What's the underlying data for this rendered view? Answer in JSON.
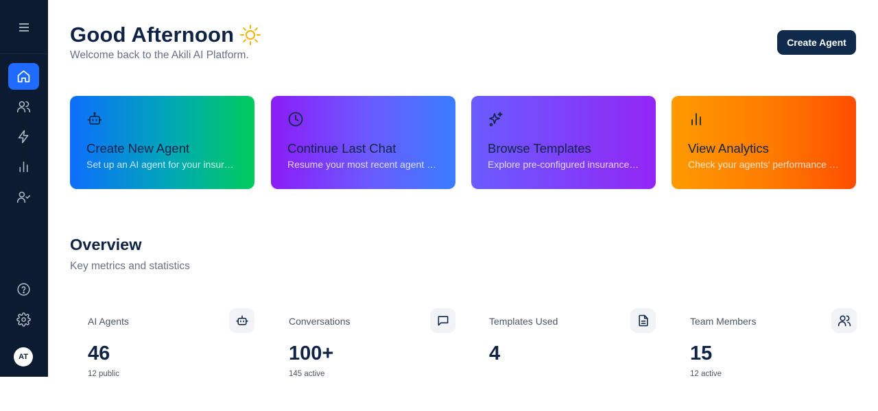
{
  "sidebar": {
    "menu_icon": "menu-icon",
    "items": [
      {
        "name": "home",
        "icon": "home-icon",
        "active": true
      },
      {
        "name": "users",
        "icon": "users-icon",
        "active": false
      },
      {
        "name": "automations",
        "icon": "lightning-icon",
        "active": false
      },
      {
        "name": "analytics",
        "icon": "bar-chart-icon",
        "active": false
      },
      {
        "name": "team",
        "icon": "user-check-icon",
        "active": false
      }
    ],
    "bottom": [
      {
        "name": "help",
        "icon": "help-circle-icon"
      },
      {
        "name": "settings",
        "icon": "gear-icon"
      }
    ],
    "avatar_initials": "AT"
  },
  "header": {
    "title": "Good Afternoon",
    "subtitle": "Welcome back to the Akili AI Platform.",
    "create_label": "Create Agent"
  },
  "quick_actions": [
    {
      "title": "Create New Agent",
      "description": "Set up an AI agent for your insurance business",
      "icon": "robot-icon"
    },
    {
      "title": "Continue Last Chat",
      "description": "Resume your most recent agent conversation",
      "icon": "clock-icon"
    },
    {
      "title": "Browse Templates",
      "description": "Explore pre-configured insurance agent templates",
      "icon": "sparkles-icon"
    },
    {
      "title": "View Analytics",
      "description": "Check your agents' performance metrics",
      "icon": "bar-chart-icon"
    }
  ],
  "overview": {
    "title": "Overview",
    "subtitle": "Key metrics and statistics",
    "metrics": [
      {
        "label": "AI Agents",
        "value": "46",
        "note": "12 public",
        "icon": "robot-icon"
      },
      {
        "label": "Conversations",
        "value": "100+",
        "note": "145 active",
        "icon": "message-icon"
      },
      {
        "label": "Templates Used",
        "value": "4",
        "note": "",
        "icon": "document-icon"
      },
      {
        "label": "Team Members",
        "value": "15",
        "note": "12 active",
        "icon": "users-icon"
      }
    ]
  },
  "colors": {
    "sidebar_bg": "#0c1b30",
    "accent": "#1f6bff",
    "primary_dark": "#102a4c"
  }
}
